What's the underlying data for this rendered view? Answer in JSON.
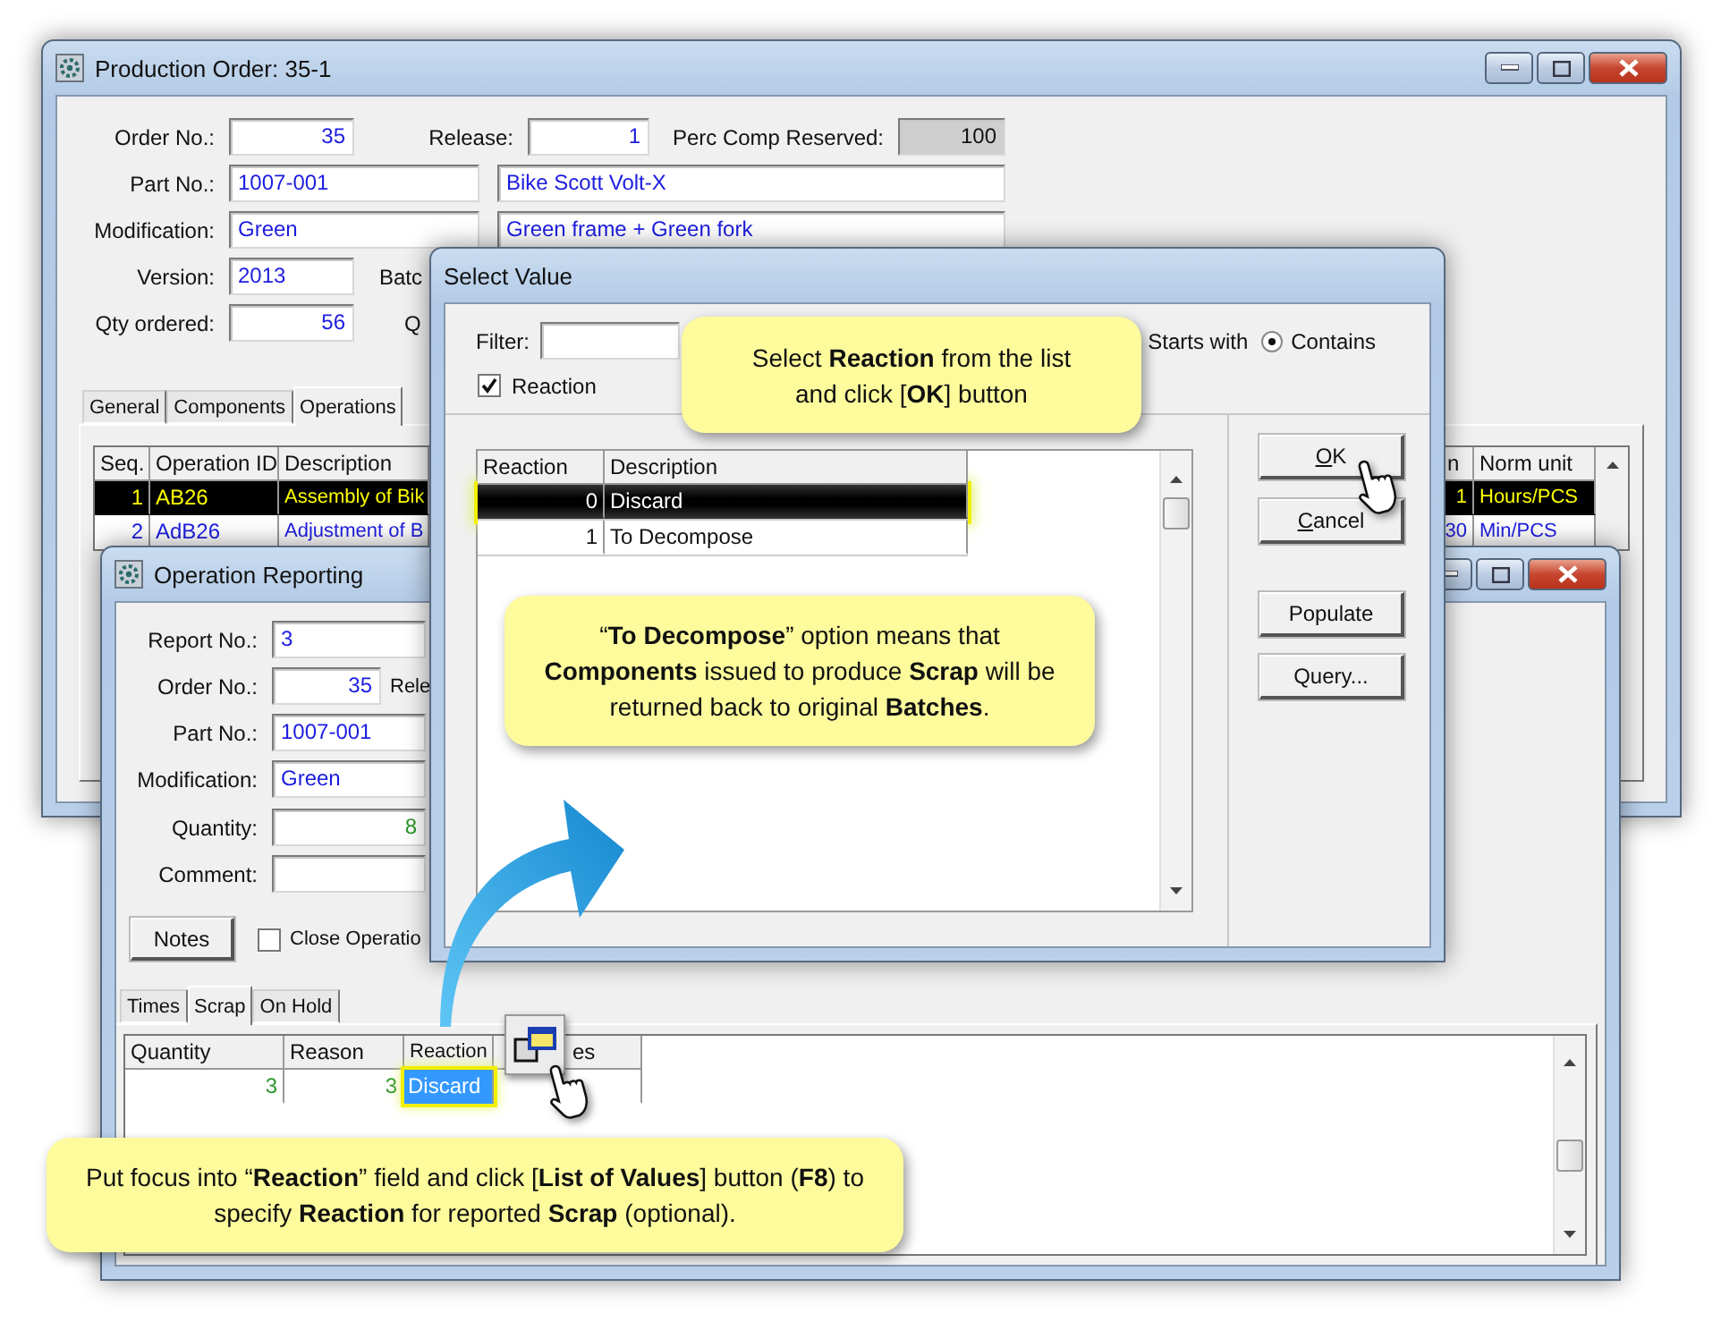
{
  "production_order": {
    "title": "Production Order: 35-1",
    "order_no": {
      "label": "Order No.:",
      "value": "35"
    },
    "release": {
      "label": "Release:",
      "value": "1"
    },
    "perc_comp_reserved": {
      "label": "Perc Comp Reserved:",
      "value": "100"
    },
    "part_no": {
      "label": "Part No.:",
      "value": "1007-001",
      "description": "Bike Scott Volt-X"
    },
    "modification": {
      "label": "Modification:",
      "value": "Green",
      "description": "Green frame + Green fork"
    },
    "version": {
      "label": "Version:",
      "value": "2013"
    },
    "batch_label": "Batc",
    "qty_ordered": {
      "label": "Qty ordered:",
      "value": "56"
    },
    "q_label": "Q",
    "tabs": [
      {
        "label": "General",
        "selected": false
      },
      {
        "label": "Components",
        "selected": false
      },
      {
        "label": "Operations",
        "selected": true
      }
    ],
    "operations": {
      "columns": [
        "Seq.",
        "Operation ID",
        "Description"
      ],
      "right_columns": [
        "n",
        "Norm unit"
      ],
      "rows": [
        {
          "cells": [
            "1",
            "AB26",
            "Assembly of Bik"
          ],
          "right_cells": [
            "1",
            "Hours/PCS"
          ],
          "selected": true
        },
        {
          "cells": [
            "2",
            "AdB26",
            "Adjustment of B"
          ],
          "right_cells": [
            "30",
            "Min/PCS"
          ],
          "selected": false
        }
      ]
    }
  },
  "operation_reporting": {
    "title": "Operation Reporting",
    "report_no": {
      "label": "Report No.:",
      "value": "3"
    },
    "order_no": {
      "label": "Order No.:",
      "value": "35"
    },
    "release_label": "Rele",
    "part_no": {
      "label": "Part No.:",
      "value": "1007-001"
    },
    "modification": {
      "label": "Modification:",
      "value": "Green"
    },
    "quantity": {
      "label": "Quantity:",
      "value": "8"
    },
    "comment": {
      "label": "Comment:"
    },
    "notes_button": "Notes",
    "close_operation": {
      "label": "Close Operatio",
      "checked": false
    },
    "tabs": [
      {
        "label": "Times",
        "selected": false
      },
      {
        "label": "Scrap",
        "selected": true
      },
      {
        "label": "On Hold",
        "selected": false
      }
    ],
    "scrap": {
      "columns": [
        "Quantity",
        "Reason",
        "Reaction",
        "es"
      ],
      "rows": [
        {
          "quantity": "3",
          "reason": "3",
          "reaction": "Discard",
          "reaction_focused": true
        }
      ]
    }
  },
  "select_value": {
    "title": "Select Value",
    "filter_label": "Filter:",
    "reaction_filter": {
      "label": "Reaction",
      "checked": true
    },
    "starts_with_label": "Starts with",
    "contains": {
      "label": "Contains",
      "selected": true
    },
    "columns": [
      "Reaction",
      "Description"
    ],
    "rows": [
      {
        "cells": [
          "0",
          "Discard"
        ],
        "selected": true
      },
      {
        "cells": [
          "1",
          "To Decompose"
        ],
        "selected": false
      }
    ],
    "buttons": [
      "OK",
      "Cancel",
      "Populate",
      "Query..."
    ]
  },
  "callouts": [
    {
      "text": "Select **Reaction** from the list and click [**OK**] button"
    },
    {
      "text": "“**To Decompose**” option means that **Components** issued to produce **Scrap** will be returned back to original **Batches**."
    },
    {
      "text": "Put focus into “**Reaction**” field and click [**List of Values**] button (**F8**) to specify **Reaction** for reported **Scrap** (optional)."
    }
  ]
}
